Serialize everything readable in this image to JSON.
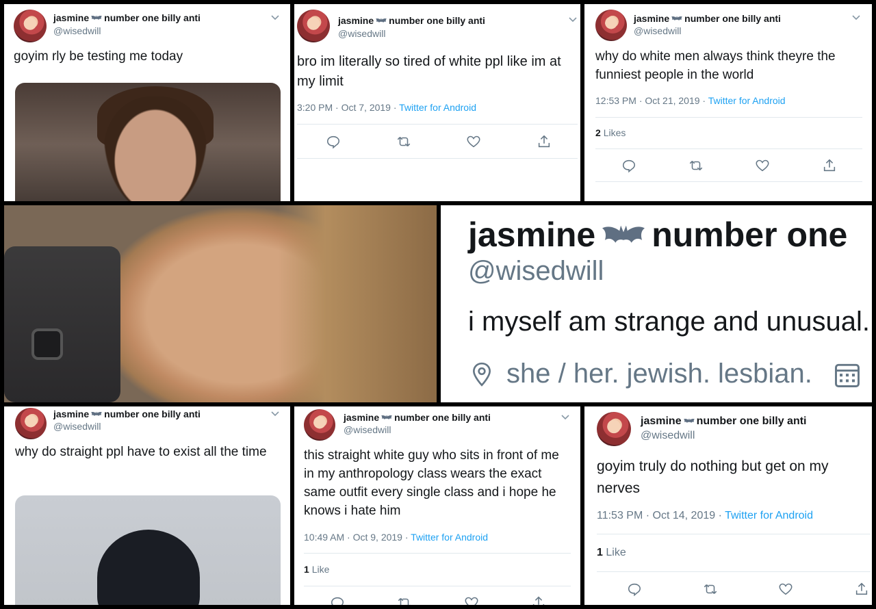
{
  "profile": {
    "display_name_part1": "jasmine",
    "display_name_part2": "number one billy anti",
    "big_name_part2": "number one",
    "handle": "@wisedwill",
    "bio": "i myself am strange and unusual.",
    "location": "she / her. jewish. lesbian."
  },
  "icons": {
    "bat": "bat-emoji-icon",
    "chevron": "chevron-down-icon",
    "reply": "reply-icon",
    "retweet": "retweet-icon",
    "like": "heart-icon",
    "share": "share-icon",
    "location": "location-pin-icon",
    "calendar": "calendar-icon"
  },
  "colors": {
    "link": "#1da1f2",
    "muted": "#657786",
    "text": "#14171a",
    "divider": "#e1e8ed"
  },
  "tweets": [
    {
      "text": "goyim rly be testing me today"
    },
    {
      "text": "bro im literally so tired of white ppl like im at my limit",
      "time": "3:20 PM · Oct 7, 2019 ·",
      "source": "Twitter for Android"
    },
    {
      "text": "why do white men always think theyre the funniest people in the world",
      "time": "12:53 PM · Oct 21, 2019 ·",
      "source": "Twitter for Android",
      "likes_count": "2",
      "likes_label": "Likes"
    },
    {
      "text": "why do straight ppl have to exist all the time"
    },
    {
      "text": "this straight white guy who sits in front of me in my anthropology class wears the exact same outfit every single class and i hope he knows i hate him",
      "time": "10:49 AM · Oct 9, 2019 ·",
      "source": "Twitter for Android",
      "likes_count": "1",
      "likes_label": "Like"
    },
    {
      "text": "goyim truly do nothing but get on my nerves",
      "time": "11:53 PM · Oct 14, 2019 ·",
      "source": "Twitter for Android",
      "likes_count": "1",
      "likes_label": "Like"
    }
  ]
}
